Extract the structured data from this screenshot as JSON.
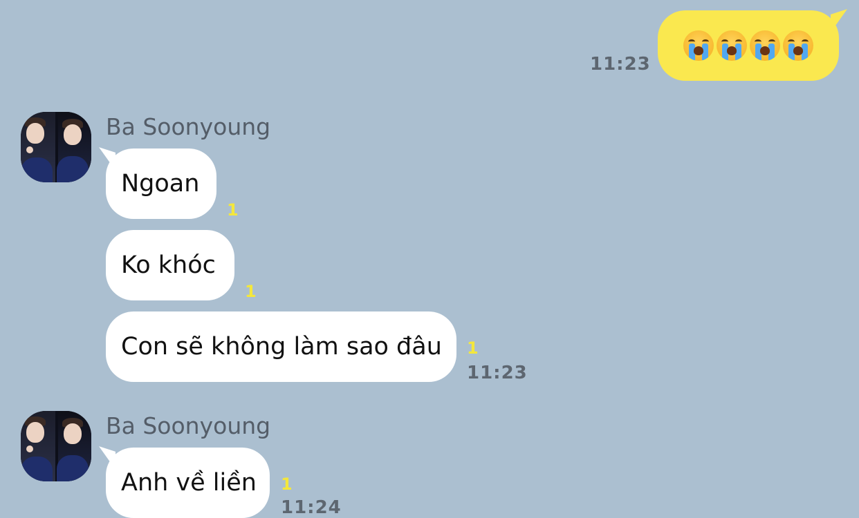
{
  "colors": {
    "background": "#abbfd0",
    "outgoing_bubble": "#fae84f",
    "incoming_bubble": "#ffffff",
    "unread_count": "#f4e73c",
    "timestamp": "#5d6670",
    "sender_name": "#545d68"
  },
  "outgoing": {
    "time": "11:23",
    "emojis": [
      "loudly-crying-face-icon",
      "loudly-crying-face-icon",
      "loudly-crying-face-icon",
      "loudly-crying-face-icon"
    ]
  },
  "groups": [
    {
      "sender": "Ba Soonyoung",
      "avatar": "avatar-photo",
      "messages": [
        {
          "text": "Ngoan",
          "unread": "1",
          "time": ""
        },
        {
          "text": "Ko khóc",
          "unread": "1",
          "time": ""
        },
        {
          "text": "Con sẽ không làm sao đâu",
          "unread": "1",
          "time": "11:23"
        }
      ]
    },
    {
      "sender": "Ba Soonyoung",
      "avatar": "avatar-photo",
      "messages": [
        {
          "text": "Anh về liền",
          "unread": "1",
          "time": "11:24"
        }
      ]
    }
  ]
}
